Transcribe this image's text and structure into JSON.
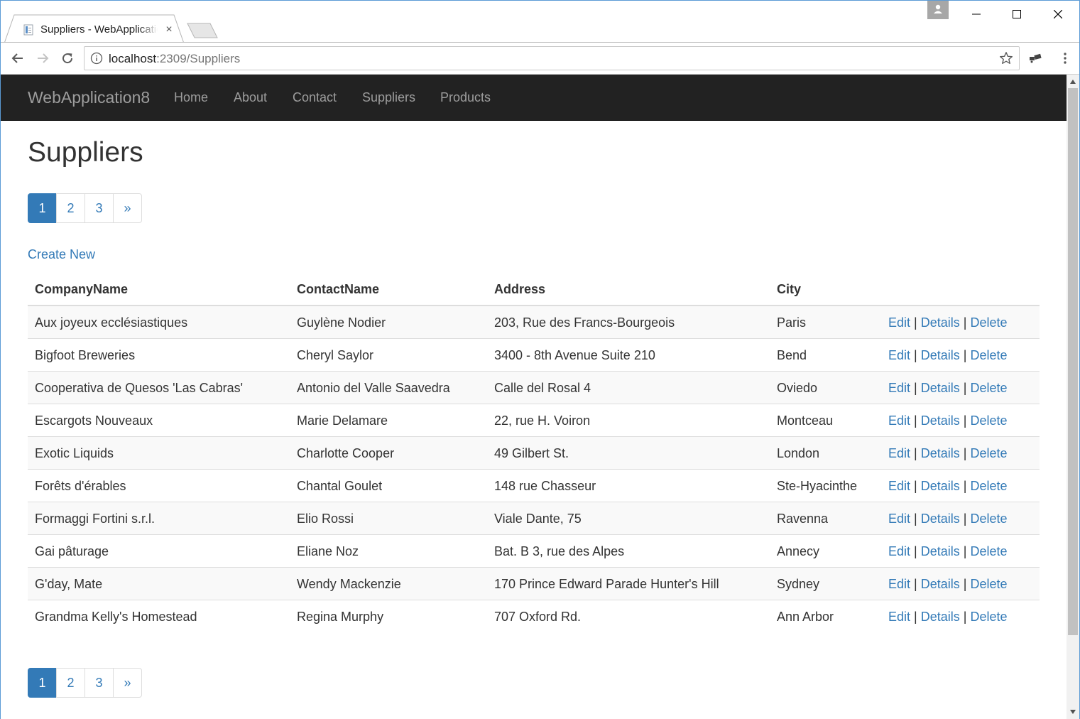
{
  "browser": {
    "tab_title": "Suppliers - WebApplication8",
    "url_host": "localhost",
    "url_port_path": ":2309/Suppliers"
  },
  "navbar": {
    "brand": "WebApplication8",
    "links": [
      "Home",
      "About",
      "Contact",
      "Suppliers",
      "Products"
    ]
  },
  "page": {
    "title": "Suppliers",
    "create_new": "Create New"
  },
  "pager": {
    "pages": [
      "1",
      "2",
      "3",
      "»"
    ],
    "active": "1"
  },
  "table": {
    "columns": [
      "CompanyName",
      "ContactName",
      "Address",
      "City"
    ],
    "actions": {
      "edit": "Edit",
      "details": "Details",
      "delete": "Delete",
      "separator": "|"
    },
    "rows": [
      [
        "Aux joyeux ecclésiastiques",
        "Guylène Nodier",
        "203, Rue des Francs-Bourgeois",
        "Paris"
      ],
      [
        "Bigfoot Breweries",
        "Cheryl Saylor",
        "3400 - 8th Avenue Suite 210",
        "Bend"
      ],
      [
        "Cooperativa de Quesos 'Las Cabras'",
        "Antonio del Valle Saavedra",
        "Calle del Rosal 4",
        "Oviedo"
      ],
      [
        "Escargots Nouveaux",
        "Marie Delamare",
        "22, rue H. Voiron",
        "Montceau"
      ],
      [
        "Exotic Liquids",
        "Charlotte Cooper",
        "49 Gilbert St.",
        "London"
      ],
      [
        "Forêts d'érables",
        "Chantal Goulet",
        "148 rue Chasseur",
        "Ste-Hyacinthe"
      ],
      [
        "Formaggi Fortini s.r.l.",
        "Elio Rossi",
        "Viale Dante, 75",
        "Ravenna"
      ],
      [
        "Gai pâturage",
        "Eliane Noz",
        "Bat. B 3, rue des Alpes",
        "Annecy"
      ],
      [
        "G'day, Mate",
        "Wendy Mackenzie",
        "170 Prince Edward Parade Hunter's Hill",
        "Sydney"
      ],
      [
        "Grandma Kelly's Homestead",
        "Regina Murphy",
        "707 Oxford Rd.",
        "Ann Arbor"
      ]
    ]
  },
  "colors": {
    "navbar_bg": "#222222",
    "link": "#337ab7",
    "pager_active": "#337ab7"
  }
}
